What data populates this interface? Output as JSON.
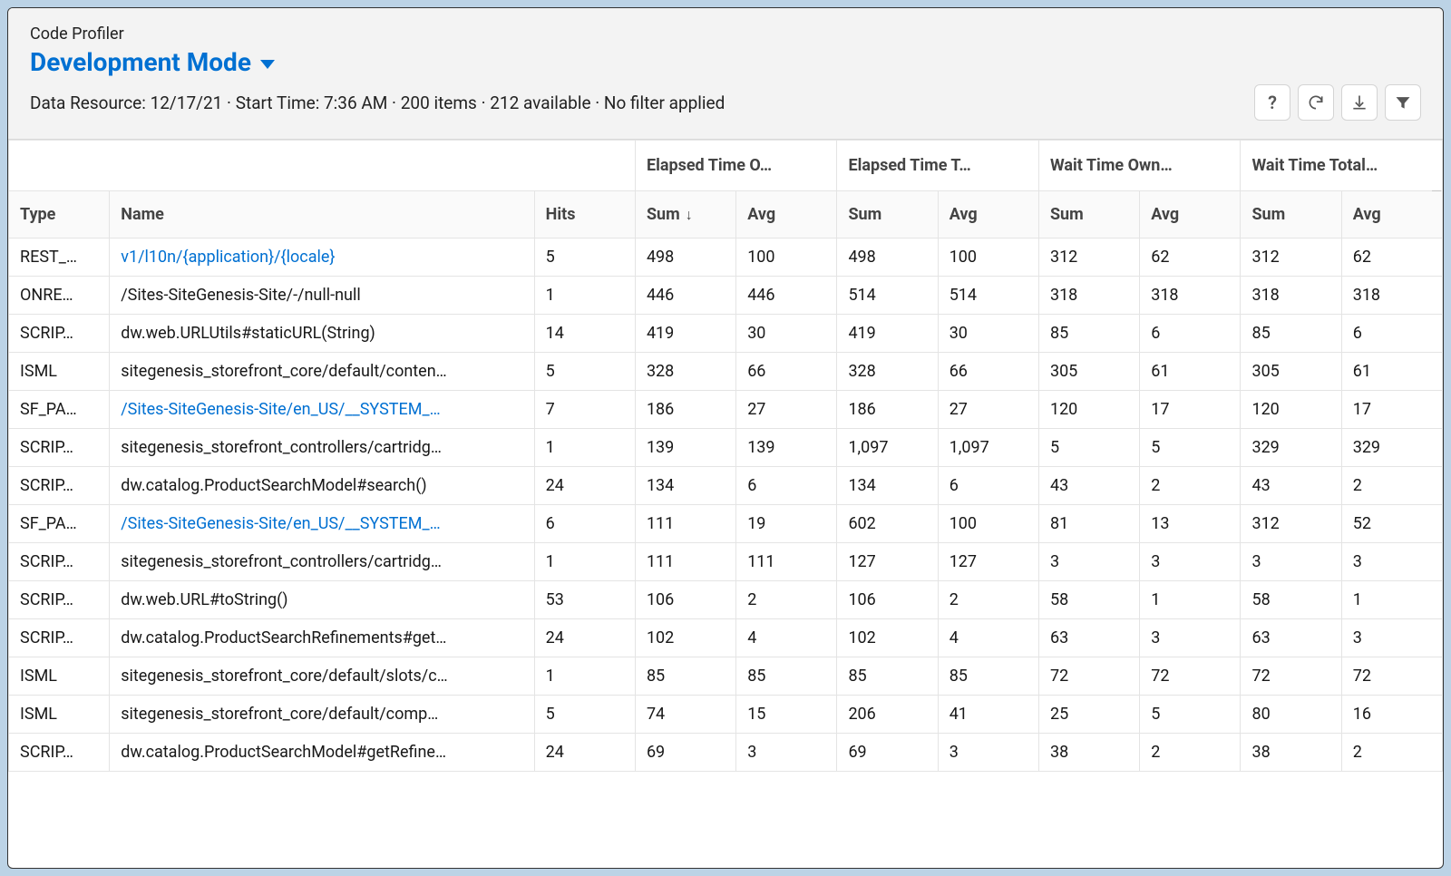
{
  "header": {
    "subtitle": "Code Profiler",
    "mode": "Development Mode",
    "info": "Data Resource: 12/17/21 · Start Time: 7:36 AM · 200 items · 212 available · No filter applied"
  },
  "toolbar": {
    "help": "Help",
    "refresh": "Refresh",
    "download": "Download",
    "filter": "Filter"
  },
  "columns": {
    "group_blank": "",
    "group_et_own": "Elapsed Time O…",
    "group_et_total": "Elapsed Time T…",
    "group_wt_own": "Wait Time Own…",
    "group_wt_total": "Wait Time Total…",
    "type": "Type",
    "name": "Name",
    "hits": "Hits",
    "sum": "Sum",
    "avg": "Avg",
    "sort_indicator": "↓"
  },
  "rows": [
    {
      "type": "REST_…",
      "name": "v1/l10n/{application}/{locale}",
      "link": true,
      "hits": "5",
      "et_own_sum": "498",
      "et_own_avg": "100",
      "et_tot_sum": "498",
      "et_tot_avg": "100",
      "wt_own_sum": "312",
      "wt_own_avg": "62",
      "wt_tot_sum": "312",
      "wt_tot_avg": "62"
    },
    {
      "type": "ONRE…",
      "name": "/Sites-SiteGenesis-Site/-/null-null",
      "link": false,
      "hits": "1",
      "et_own_sum": "446",
      "et_own_avg": "446",
      "et_tot_sum": "514",
      "et_tot_avg": "514",
      "wt_own_sum": "318",
      "wt_own_avg": "318",
      "wt_tot_sum": "318",
      "wt_tot_avg": "318"
    },
    {
      "type": "SCRIP…",
      "name": "dw.web.URLUtils#staticURL(String)",
      "link": false,
      "hits": "14",
      "et_own_sum": "419",
      "et_own_avg": "30",
      "et_tot_sum": "419",
      "et_tot_avg": "30",
      "wt_own_sum": "85",
      "wt_own_avg": "6",
      "wt_tot_sum": "85",
      "wt_tot_avg": "6"
    },
    {
      "type": "ISML",
      "name": "sitegenesis_storefront_core/default/conten…",
      "link": false,
      "hits": "5",
      "et_own_sum": "328",
      "et_own_avg": "66",
      "et_tot_sum": "328",
      "et_tot_avg": "66",
      "wt_own_sum": "305",
      "wt_own_avg": "61",
      "wt_tot_sum": "305",
      "wt_tot_avg": "61"
    },
    {
      "type": "SF_PA…",
      "name": "/Sites-SiteGenesis-Site/en_US/__SYSTEM_…",
      "link": true,
      "hits": "7",
      "et_own_sum": "186",
      "et_own_avg": "27",
      "et_tot_sum": "186",
      "et_tot_avg": "27",
      "wt_own_sum": "120",
      "wt_own_avg": "17",
      "wt_tot_sum": "120",
      "wt_tot_avg": "17"
    },
    {
      "type": "SCRIP…",
      "name": "sitegenesis_storefront_controllers/cartridg…",
      "link": false,
      "hits": "1",
      "et_own_sum": "139",
      "et_own_avg": "139",
      "et_tot_sum": "1,097",
      "et_tot_avg": "1,097",
      "wt_own_sum": "5",
      "wt_own_avg": "5",
      "wt_tot_sum": "329",
      "wt_tot_avg": "329"
    },
    {
      "type": "SCRIP…",
      "name": "dw.catalog.ProductSearchModel#search()",
      "link": false,
      "hits": "24",
      "et_own_sum": "134",
      "et_own_avg": "6",
      "et_tot_sum": "134",
      "et_tot_avg": "6",
      "wt_own_sum": "43",
      "wt_own_avg": "2",
      "wt_tot_sum": "43",
      "wt_tot_avg": "2"
    },
    {
      "type": "SF_PA…",
      "name": "/Sites-SiteGenesis-Site/en_US/__SYSTEM_…",
      "link": true,
      "hits": "6",
      "et_own_sum": "111",
      "et_own_avg": "19",
      "et_tot_sum": "602",
      "et_tot_avg": "100",
      "wt_own_sum": "81",
      "wt_own_avg": "13",
      "wt_tot_sum": "312",
      "wt_tot_avg": "52"
    },
    {
      "type": "SCRIP…",
      "name": "sitegenesis_storefront_controllers/cartridg…",
      "link": false,
      "hits": "1",
      "et_own_sum": "111",
      "et_own_avg": "111",
      "et_tot_sum": "127",
      "et_tot_avg": "127",
      "wt_own_sum": "3",
      "wt_own_avg": "3",
      "wt_tot_sum": "3",
      "wt_tot_avg": "3"
    },
    {
      "type": "SCRIP…",
      "name": "dw.web.URL#toString()",
      "link": false,
      "hits": "53",
      "et_own_sum": "106",
      "et_own_avg": "2",
      "et_tot_sum": "106",
      "et_tot_avg": "2",
      "wt_own_sum": "58",
      "wt_own_avg": "1",
      "wt_tot_sum": "58",
      "wt_tot_avg": "1"
    },
    {
      "type": "SCRIP…",
      "name": "dw.catalog.ProductSearchRefinements#get…",
      "link": false,
      "hits": "24",
      "et_own_sum": "102",
      "et_own_avg": "4",
      "et_tot_sum": "102",
      "et_tot_avg": "4",
      "wt_own_sum": "63",
      "wt_own_avg": "3",
      "wt_tot_sum": "63",
      "wt_tot_avg": "3"
    },
    {
      "type": "ISML",
      "name": "sitegenesis_storefront_core/default/slots/c…",
      "link": false,
      "hits": "1",
      "et_own_sum": "85",
      "et_own_avg": "85",
      "et_tot_sum": "85",
      "et_tot_avg": "85",
      "wt_own_sum": "72",
      "wt_own_avg": "72",
      "wt_tot_sum": "72",
      "wt_tot_avg": "72"
    },
    {
      "type": "ISML",
      "name": "sitegenesis_storefront_core/default/comp…",
      "link": false,
      "hits": "5",
      "et_own_sum": "74",
      "et_own_avg": "15",
      "et_tot_sum": "206",
      "et_tot_avg": "41",
      "wt_own_sum": "25",
      "wt_own_avg": "5",
      "wt_tot_sum": "80",
      "wt_tot_avg": "16"
    },
    {
      "type": "SCRIP…",
      "name": "dw.catalog.ProductSearchModel#getRefine…",
      "link": false,
      "hits": "24",
      "et_own_sum": "69",
      "et_own_avg": "3",
      "et_tot_sum": "69",
      "et_tot_avg": "3",
      "wt_own_sum": "38",
      "wt_own_avg": "2",
      "wt_tot_sum": "38",
      "wt_tot_avg": "2"
    }
  ]
}
